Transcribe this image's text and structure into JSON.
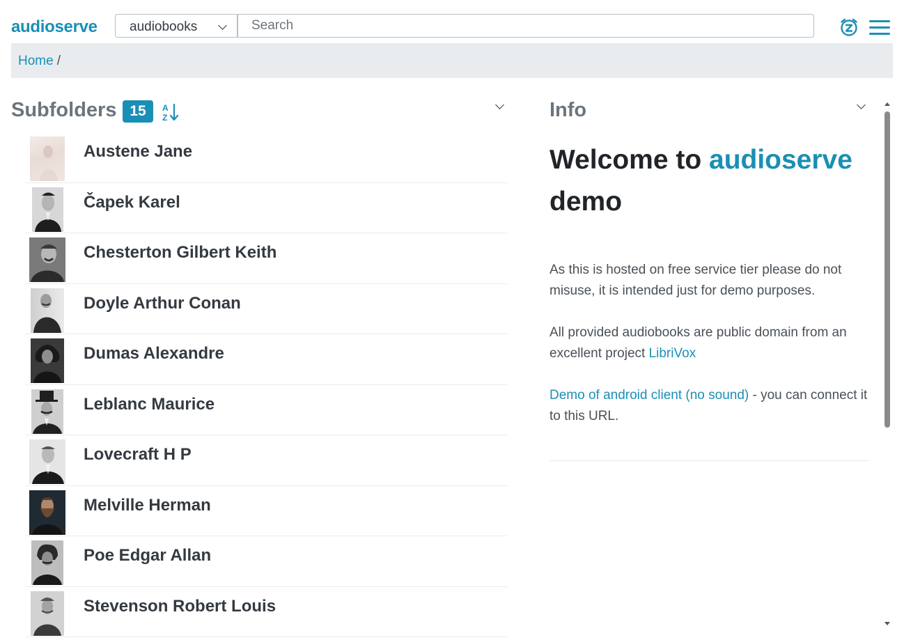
{
  "header": {
    "brand": "audioserve",
    "collection": "audiobooks",
    "search_placeholder": "Search",
    "sleep_timer_icon": "sleep-timer-icon",
    "menu_icon": "hamburger-menu-icon"
  },
  "breadcrumb": {
    "home": "Home",
    "separator": "/"
  },
  "subfolders": {
    "title": "Subfolders",
    "count": "15",
    "sort_icon": "sort-alpha-icon",
    "items": [
      "Austene Jane",
      "Čapek Karel",
      "Chesterton Gilbert Keith",
      "Doyle Arthur Conan",
      "Dumas Alexandre",
      "Leblanc Maurice",
      "Lovecraft H P",
      "Melville Herman",
      "Poe Edgar Allan",
      "Stevenson Robert Louis"
    ]
  },
  "info": {
    "title": "Info",
    "welcome_prefix": "Welcome to",
    "welcome_brand": "audioserve",
    "welcome_suffix": "demo",
    "para1": "As this is hosted on free service tier please do not misuse, it is intended just for demo purposes.",
    "para2_text": "All provided audiobooks are public domain from an excellent project",
    "para2_link": "LibriVox",
    "para3_link": "Demo of android client (no sound)",
    "para3_text": " - you can connect it to this URL."
  },
  "colors": {
    "accent": "#1a8fb5",
    "breadcrumb_bg": "#e9ecef",
    "muted": "#6c757d"
  }
}
